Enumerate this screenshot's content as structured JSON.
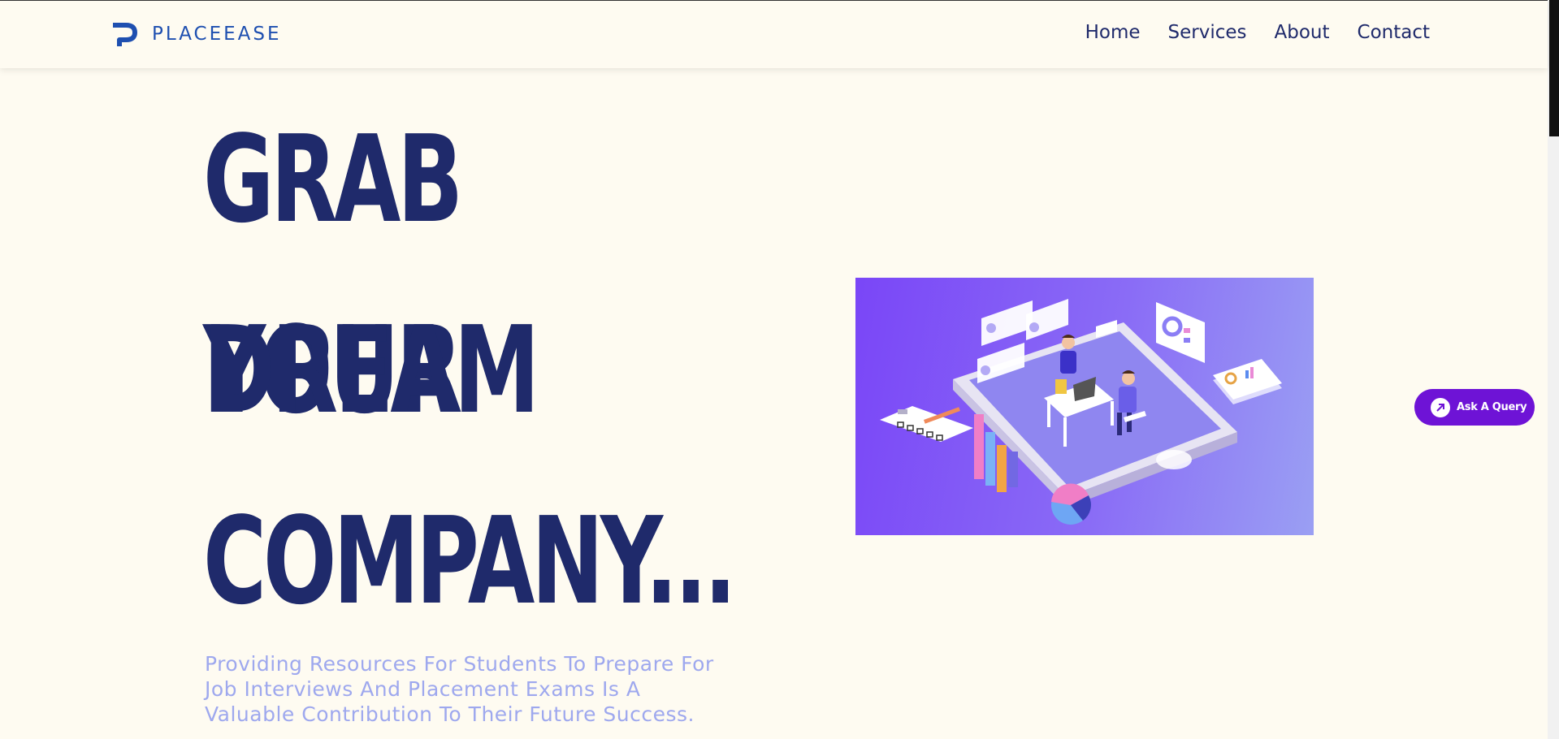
{
  "header": {
    "brand": "PLACEEASE",
    "nav": [
      "Home",
      "Services",
      "About",
      "Contact"
    ]
  },
  "hero": {
    "title_lines": [
      "GRAB YOUR",
      "DREAM",
      "COMPANY..."
    ],
    "subtitle": "Providing Resources For Students To Prepare For Job Interviews And Placement Exams Is A Valuable Contribution To Their Future Success."
  },
  "ask_query": {
    "label": "Ask A Query"
  },
  "colors": {
    "background": "#fefbf1",
    "title": "#1f2a6b",
    "brand": "#1e4fb0",
    "subtitle": "#9ea8ee",
    "ask_button": "#6e13d6",
    "illustration_start": "#7a46f7",
    "illustration_end": "#9a9ff3"
  },
  "icons": {
    "logo": "p-logo-icon",
    "ask": "arrow-up-right-icon"
  },
  "scrollbar": {
    "position": 0.0
  }
}
